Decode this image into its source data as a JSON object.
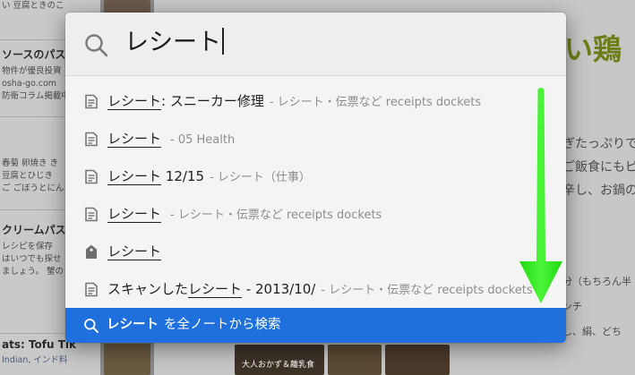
{
  "background": {
    "left_notes": [
      {
        "title": "",
        "lines": [
          "い 豆腐ときのこ"
        ]
      },
      {
        "title": "ソースのパス",
        "lines": [
          "物件が優良投資",
          "osha-go.com",
          "防衛コラム掲載中"
        ]
      },
      {
        "title": "",
        "lines": [
          "春菊 卵焼き き",
          "豆腐とひじき",
          "ご ごぼうとにん"
        ]
      },
      {
        "title": "クリームパス",
        "lines": [
          "レシピを保存",
          "はいつでも探せ",
          "ましょう。 蟹の"
        ]
      },
      {
        "title": "ats: Tofu Tik",
        "lines": [
          "Indian, インド料"
        ]
      }
    ],
    "right_title": "い鶏",
    "right_fragments": [
      "ぎたっぷりで",
      "ご飯食にもピッ",
      "辛し、お鍋の",
      "分（もちろん半",
      "ンチ",
      "し、絹、どち"
    ],
    "caption": "大人おかず＆離乳食"
  },
  "search": {
    "query": "レシート",
    "icon": "search-icon"
  },
  "results": [
    {
      "icon": "note-icon",
      "match": "レシート",
      "rest": ": スニーカー修理",
      "meta": "- レシート・伝票など receipts dockets"
    },
    {
      "icon": "note-icon",
      "match": "レシート",
      "rest": "",
      "meta": "- 05 Health"
    },
    {
      "icon": "note-icon",
      "match": "レシート",
      "rest": " 12/15",
      "meta": "- レシート（仕事）"
    },
    {
      "icon": "note-icon",
      "match": "レシート",
      "rest": "",
      "meta": "- レシート・伝票など receipts dockets"
    },
    {
      "icon": "tag-icon",
      "match": "レシート",
      "rest": "",
      "meta": ""
    },
    {
      "icon": "note-icon",
      "prefix": "スキャンした",
      "match": "レシート",
      "rest": " - 2013/10/",
      "meta": "- レシート・伝票など receipts dockets"
    }
  ],
  "footer": {
    "query": "レシート",
    "label": "を全ノートから検索",
    "icon": "search-icon"
  },
  "colors": {
    "accent": "#1f6fdc",
    "arrow": "#2ee81f"
  }
}
